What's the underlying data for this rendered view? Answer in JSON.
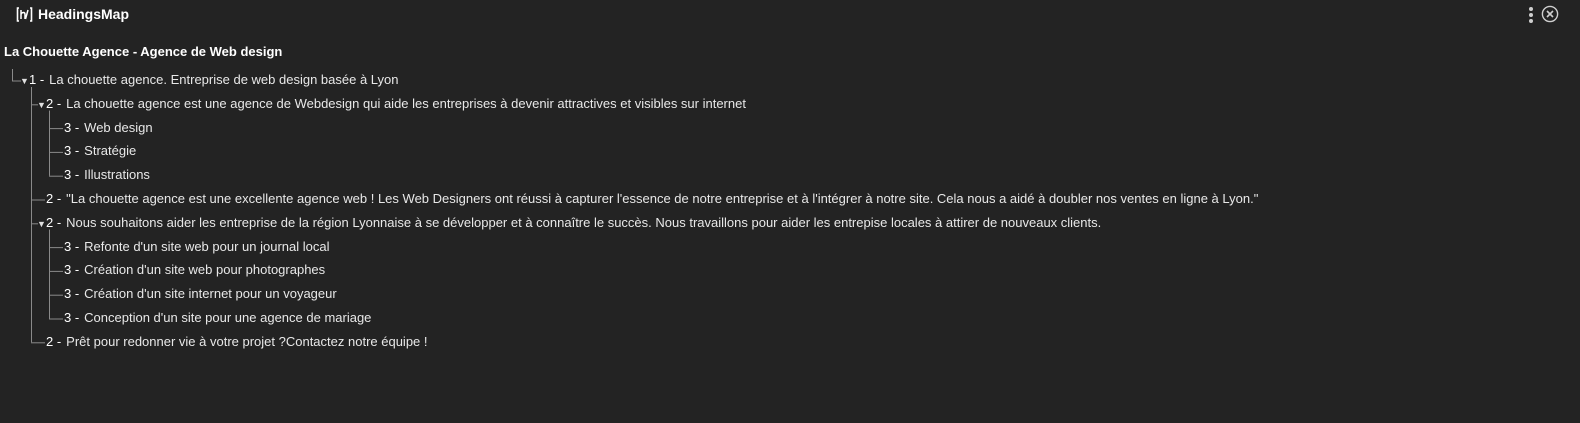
{
  "app": {
    "title": "HeadingsMap",
    "logo_text": "[h]"
  },
  "page": {
    "title": "La Chouette Agence - Agence de Web design"
  },
  "headings": [
    {
      "level": "1 -",
      "text": "La chouette agence. Entreprise de web design basée à Lyon",
      "expanded": true
    },
    {
      "level": "2 -",
      "text": "La chouette agence est une agence de Webdesign qui aide les entreprises à devenir attractives et visibles sur internet",
      "expanded": true
    },
    {
      "level": "3 -",
      "text": "Web design"
    },
    {
      "level": "3 -",
      "text": "Stratégie"
    },
    {
      "level": "3 -",
      "text": "Illustrations"
    },
    {
      "level": "2 -",
      "text": "\"La chouette agence est une excellente agence web ! Les Web Designers ont réussi à capturer l'essence de notre entreprise et à l'intégrer à notre site. Cela nous a aidé à doubler nos ventes en ligne à Lyon.\""
    },
    {
      "level": "2 -",
      "text": "Nous souhaitons aider les entreprise de la région Lyonnaise à se développer et à connaître le succès. Nous travaillons pour aider les entrepise locales à attirer de nouveaux clients.",
      "expanded": true
    },
    {
      "level": "3 -",
      "text": "Refonte d'un site web pour un journal local"
    },
    {
      "level": "3 -",
      "text": "Création d'un site web pour photographes"
    },
    {
      "level": "3 -",
      "text": "Création d'un site internet pour un voyageur"
    },
    {
      "level": "3 -",
      "text": "Conception d'un site pour une agence de mariage"
    },
    {
      "level": "2 -",
      "text": "Prêt pour redonner vie à votre projet ?Contactez notre équipe !"
    }
  ],
  "icons": {
    "logo": "headingsmap-logo-icon",
    "menu": "kebab-menu-icon",
    "close": "close-circle-icon",
    "expand": "triangle-down-icon"
  },
  "colors": {
    "background": "#232323",
    "text": "#e8e8e8",
    "lines": "#8a8a8a"
  }
}
